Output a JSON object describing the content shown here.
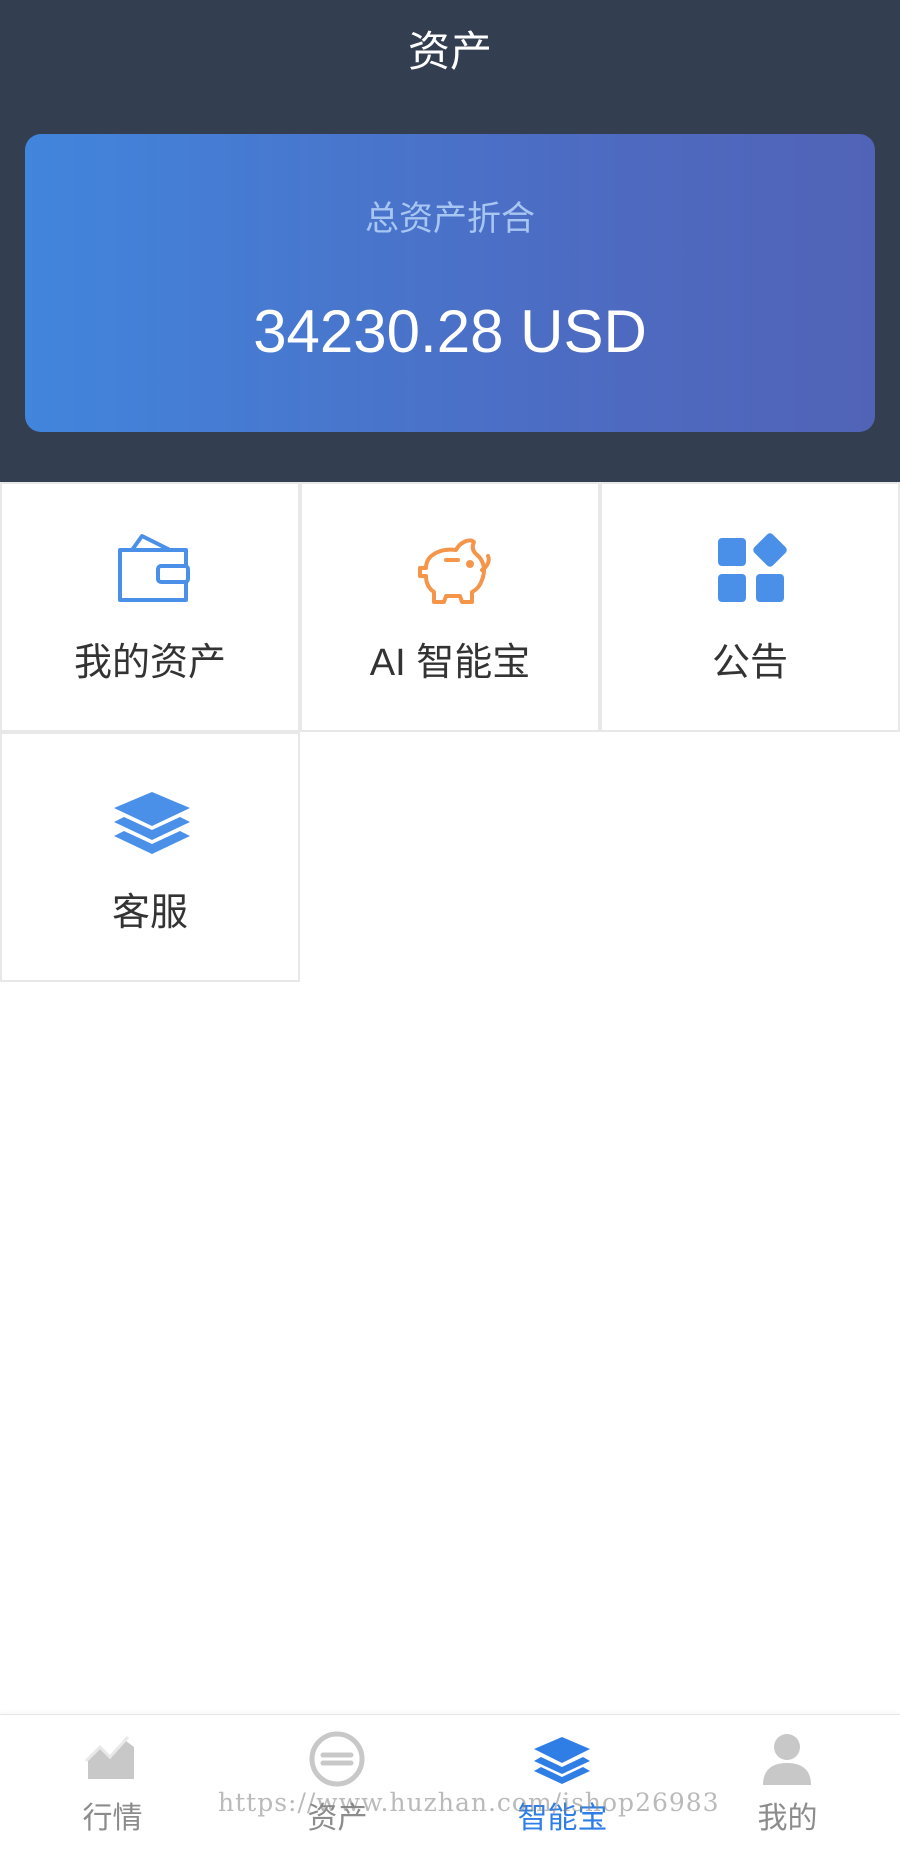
{
  "header": {
    "title": "资产"
  },
  "asset_card": {
    "label": "总资产折合",
    "value": "34230.28 USD"
  },
  "menu": {
    "items": [
      {
        "label": "我的资产",
        "icon": "wallet-icon",
        "color": "#4a90e8"
      },
      {
        "label": "AI 智能宝",
        "icon": "piggy-bank-icon",
        "color": "#f5954a"
      },
      {
        "label": "公告",
        "icon": "apps-icon",
        "color": "#4a90e8"
      },
      {
        "label": "客服",
        "icon": "layers-icon",
        "color": "#4a90e8"
      }
    ]
  },
  "tabbar": {
    "active_color": "#2f7ee6",
    "inactive_color": "#8c8c8c",
    "tabs": [
      {
        "label": "行情",
        "icon": "chart-icon",
        "active": false
      },
      {
        "label": "资产",
        "icon": "exchange-icon",
        "active": false
      },
      {
        "label": "智能宝",
        "icon": "layers-icon",
        "active": true
      },
      {
        "label": "我的",
        "icon": "user-icon",
        "active": false
      }
    ]
  },
  "watermark": {
    "text": "https://www.huzhan.com/ishop26983"
  }
}
